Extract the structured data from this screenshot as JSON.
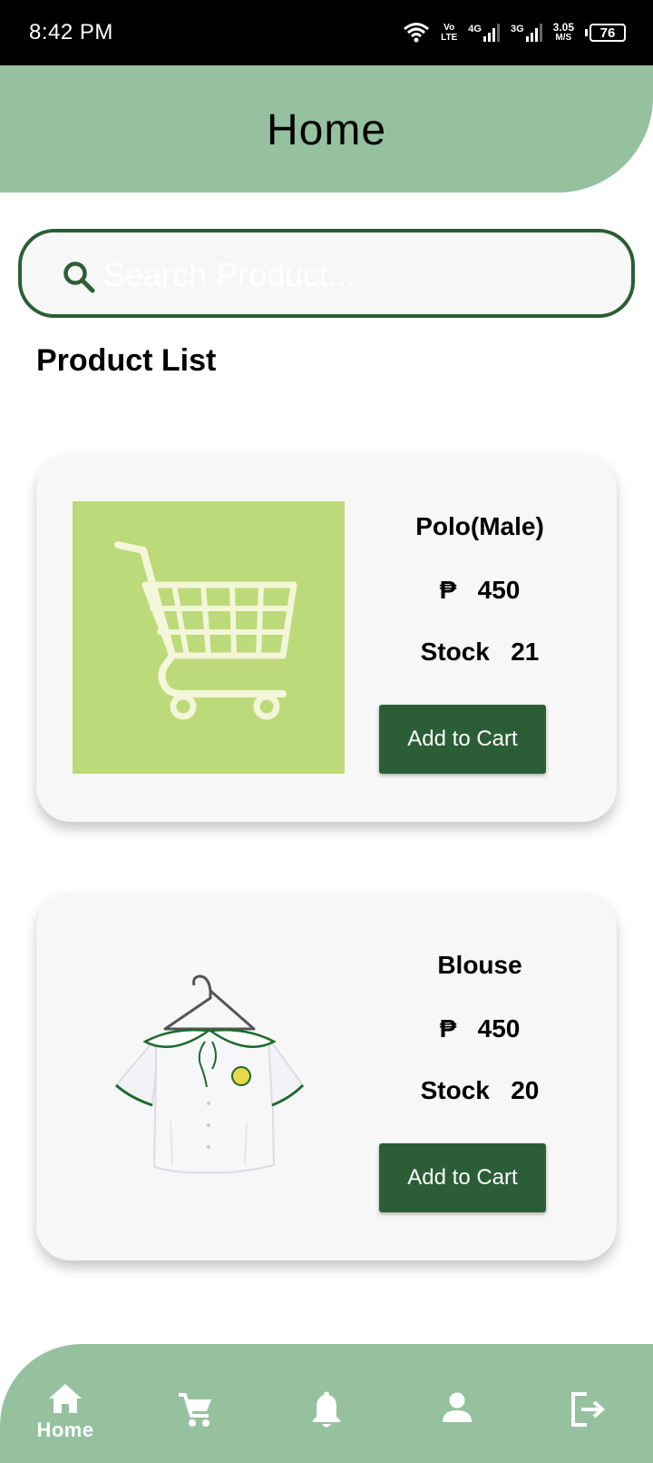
{
  "status_bar": {
    "time": "8:42 PM",
    "volte_top": "Vo",
    "volte_bottom": "LTE",
    "net1": "4G",
    "net2": "3G",
    "speed_value": "3.05",
    "speed_unit": "M/S",
    "battery": "76"
  },
  "header": {
    "title": "Home"
  },
  "search": {
    "placeholder": "Search Product..."
  },
  "section_title": "Product List",
  "currency_symbol": "₱",
  "stock_label": "Stock",
  "products": [
    {
      "name": "Polo(Male)",
      "price": "450",
      "stock": "21",
      "add_label": "Add to Cart",
      "image": "shopping-cart-placeholder"
    },
    {
      "name": "Blouse",
      "price": "450",
      "stock": "20",
      "add_label": "Add to Cart",
      "image": "white-blouse-on-hanger"
    }
  ],
  "bottom_nav": {
    "home_label": "Home",
    "icons": [
      "home-icon",
      "cart-icon",
      "bell-icon",
      "profile-icon",
      "logout-icon"
    ]
  },
  "colors": {
    "header_bg": "#95c19f",
    "accent": "#2b5e36",
    "card_bg": "#f7f7f7",
    "placeholder_img_bg": "#bcda79"
  }
}
